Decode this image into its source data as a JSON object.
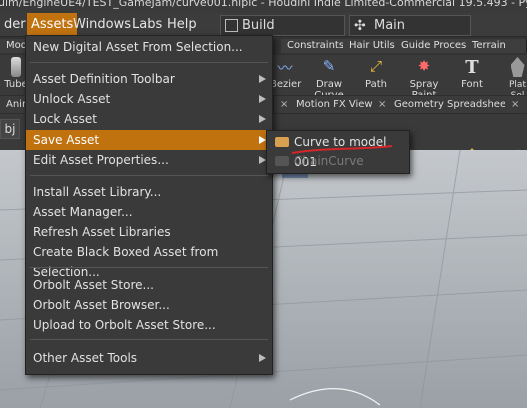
{
  "title_bar": {
    "text": "ulm/EngineUE4/TEST_GameJam/curve001.hiplc - Houdini Indie Limited-Commercial 19.5.493 - Py3.9"
  },
  "menubar": {
    "items": [
      "der",
      "Assets",
      "Windows",
      "Labs",
      "Help"
    ],
    "build_label": "Build",
    "main_label": "Main"
  },
  "shelf_tabs": [
    "Mode",
    "Constraints",
    "Hair Utils",
    "Guide Process",
    "Terrain FX"
  ],
  "shelf_tools": [
    "Tube",
    "Bezier",
    "Draw Curve",
    "Path",
    "Spray Paint",
    "Font",
    "Plat Sol"
  ],
  "pane_tabs": {
    "left": "Anim",
    "motion_fx": "Motion FX View",
    "geometry": "Geometry Spreadsheet"
  },
  "path_bar": {
    "label": "bj"
  },
  "assets_menu": {
    "items": [
      {
        "label": "New Digital Asset From Selection...",
        "submenu": false
      },
      {
        "label": "Asset Definition Toolbar",
        "submenu": true
      },
      {
        "label": "Unlock Asset",
        "submenu": true
      },
      {
        "label": "Lock Asset",
        "submenu": true
      },
      {
        "label": "Save Asset",
        "submenu": true,
        "selected": true
      },
      {
        "label": "Edit Asset Properties...",
        "submenu": true
      },
      {
        "label": "Install Asset Library...",
        "submenu": false
      },
      {
        "label": "Asset Manager...",
        "submenu": false
      },
      {
        "label": "Refresh Asset Libraries",
        "submenu": false
      },
      {
        "label": "Create Black Boxed Asset from Selection...",
        "submenu": false
      },
      {
        "label": "Orbolt Asset Store...",
        "submenu": false
      },
      {
        "label": "Orbolt Asset Browser...",
        "submenu": false
      },
      {
        "label": "Upload to Orbolt Asset Store...",
        "submenu": false
      },
      {
        "label": "Other Asset Tools",
        "submenu": true
      }
    ]
  },
  "save_submenu": {
    "items": [
      {
        "label": "Curve to model 001",
        "enabled": true
      },
      {
        "label": "ChainCurve",
        "enabled": false
      }
    ]
  },
  "colors": {
    "accent": "#c0720f",
    "annotation": "#d4262b"
  }
}
